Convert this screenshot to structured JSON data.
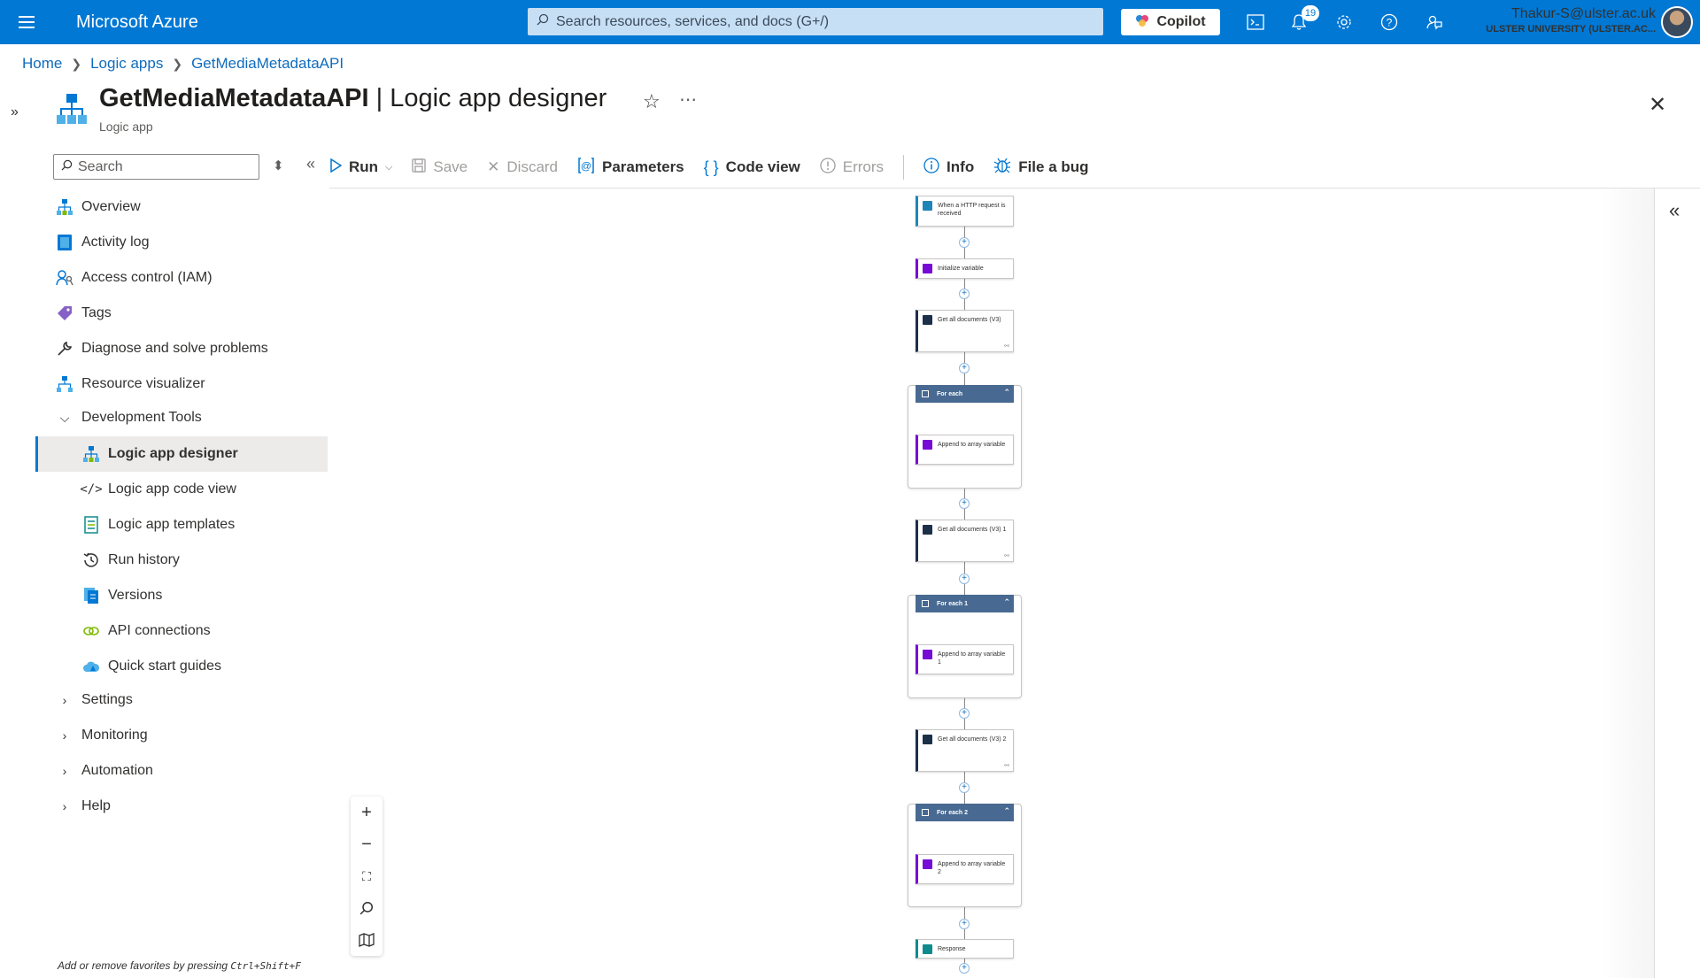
{
  "topbar": {
    "brand": "Microsoft Azure",
    "search_placeholder": "Search resources, services, and docs (G+/)",
    "copilot_label": "Copilot",
    "notification_count": "19",
    "user_name": "Thakur-S@ulster.ac.uk",
    "user_org": "ULSTER UNIVERSITY (ULSTER.AC..."
  },
  "breadcrumb": [
    "Home",
    "Logic apps",
    "GetMediaMetadataAPI"
  ],
  "header": {
    "resource_name": "GetMediaMetadataAPI",
    "title_suffix": " | Logic app designer",
    "subtitle": "Logic app"
  },
  "nav": {
    "search_placeholder": "Search",
    "items": [
      {
        "label": "Overview",
        "icon": "overview-icon"
      },
      {
        "label": "Activity log",
        "icon": "activity-log-icon"
      },
      {
        "label": "Access control (IAM)",
        "icon": "iam-icon"
      },
      {
        "label": "Tags",
        "icon": "tag-icon"
      },
      {
        "label": "Diagnose and solve problems",
        "icon": "wrench-icon"
      },
      {
        "label": "Resource visualizer",
        "icon": "visualizer-icon"
      },
      {
        "label": "Development Tools",
        "icon": "chevron-down-icon"
      },
      {
        "label": "Logic app designer",
        "icon": "designer-icon"
      },
      {
        "label": "Logic app code view",
        "icon": "code-icon"
      },
      {
        "label": "Logic app templates",
        "icon": "template-icon"
      },
      {
        "label": "Run history",
        "icon": "history-icon"
      },
      {
        "label": "Versions",
        "icon": "versions-icon"
      },
      {
        "label": "API connections",
        "icon": "api-connection-icon"
      },
      {
        "label": "Quick start guides",
        "icon": "cloud-icon"
      },
      {
        "label": "Settings",
        "icon": "chevron-right-icon"
      },
      {
        "label": "Monitoring",
        "icon": "chevron-right-icon"
      },
      {
        "label": "Automation",
        "icon": "chevron-right-icon"
      },
      {
        "label": "Help",
        "icon": "chevron-right-icon"
      }
    ],
    "favorites_hint": "Add or remove favorites by pressing ",
    "favorites_shortcut": "Ctrl+Shift+F"
  },
  "toolbar": {
    "run": "Run",
    "save": "Save",
    "discard": "Discard",
    "parameters": "Parameters",
    "code_view": "Code view",
    "errors": "Errors",
    "info": "Info",
    "file_bug": "File a bug"
  },
  "workflow": {
    "trigger": "When a HTTP request is received",
    "init_variable": "Initialize variable",
    "get_docs_1": "Get all documents (V3)",
    "foreach_1": "For each",
    "append_1": "Append to array variable",
    "get_docs_2": "Get all documents (V3) 1",
    "foreach_2": "For each 1",
    "append_2": "Append to array variable 1",
    "get_docs_3": "Get all documents (V3) 2",
    "foreach_3": "For each 2",
    "append_3": "Append to array variable 2",
    "response": "Response"
  },
  "colors": {
    "azure_blue": "#0078d4",
    "trigger": "#1f85b8",
    "variable": "#770bd6",
    "cosmos": "#1c3049",
    "scope": "#486991",
    "response": "#0f8b8d"
  }
}
